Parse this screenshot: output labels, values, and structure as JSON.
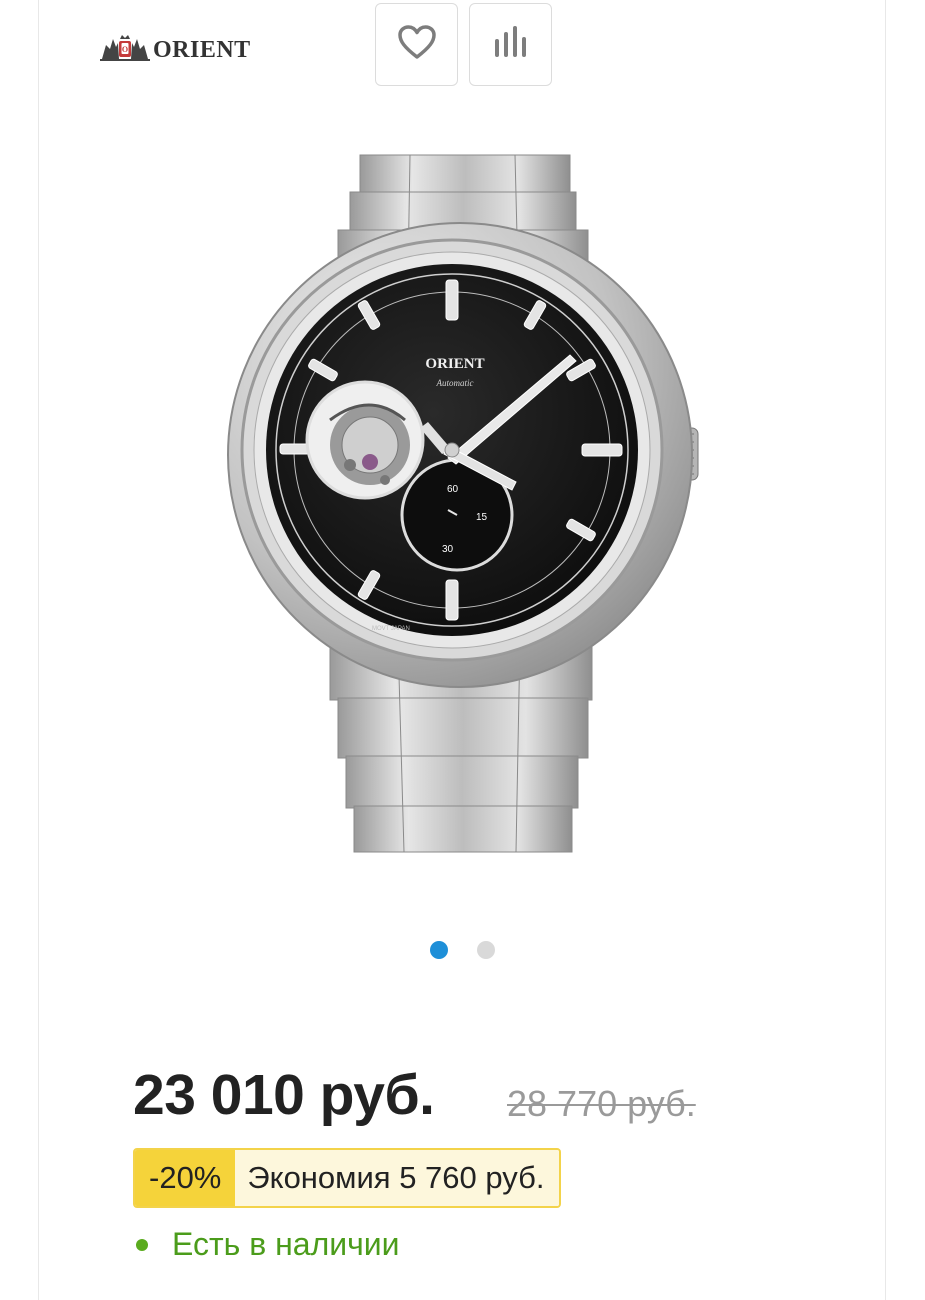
{
  "brand": {
    "name": "ORIENT",
    "logo_icon": "orient-crest-icon"
  },
  "actions": [
    {
      "id": "favorite",
      "icon": "heart-icon"
    },
    {
      "id": "compare",
      "icon": "bar-chart-icon"
    }
  ],
  "product": {
    "image_icon": "watch-photo",
    "dial": {
      "brand": "ORIENT",
      "subtitle": "Automatic",
      "sub_marks": [
        "60",
        "15",
        "30"
      ],
      "bottom_left": "MOVT JAPAN"
    }
  },
  "slider": {
    "count": 2,
    "active_index": 0
  },
  "pricing": {
    "price": "23 010 руб.",
    "old_price": "28 770 руб.",
    "discount": "-20%",
    "saving": "Экономия 5 760 руб."
  },
  "availability": {
    "text": "Есть в наличии"
  },
  "colors": {
    "accent_blue": "#1e8fd8",
    "discount_yellow": "#f5d33a",
    "stock_green": "#4b9c1b"
  }
}
